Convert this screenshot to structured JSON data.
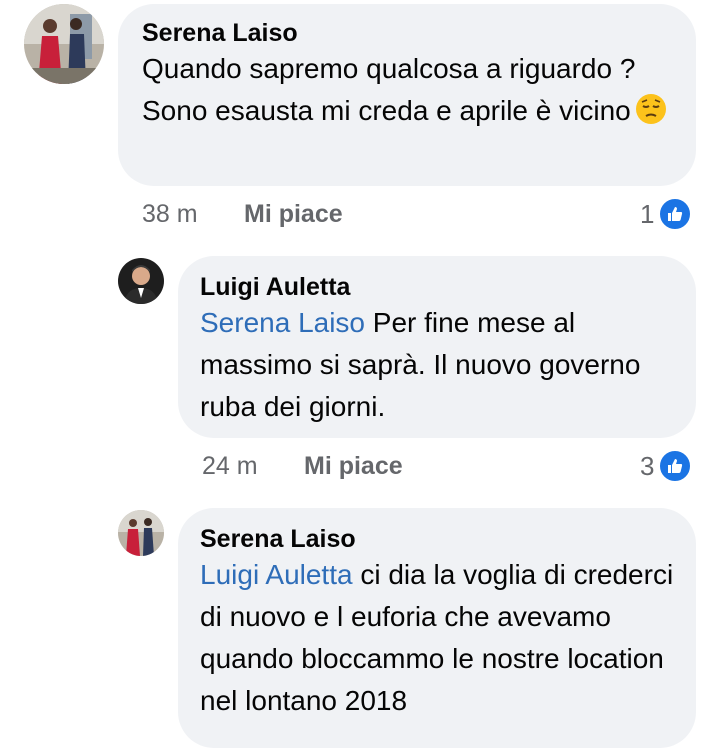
{
  "comments": [
    {
      "author": "Serena Laiso",
      "text": "Quando sapremo qualcosa a riguardo ? Sono esausta mi creda e aprile è vicino",
      "emoji": "pensive-face",
      "time": "38 m",
      "like_label": "Mi piace",
      "reaction_count": "1"
    },
    {
      "author": "Luigi Auletta",
      "mention": "Serena Laiso",
      "text": "Per fine mese al massimo si saprà.  Il nuovo governo ruba dei giorni.",
      "time": "24 m",
      "like_label": "Mi piace",
      "reaction_count": "3"
    },
    {
      "author": "Serena Laiso",
      "mention": "Luigi Auletta",
      "text": "ci dia la voglia di crederci di nuovo e l euforia che avevamo quando bloccammo le nostre location nel lontano 2018"
    }
  ],
  "colors": {
    "bubble": "#f0f2f5",
    "mention": "#2e6db8",
    "like_badge": "#1b74e4",
    "meta": "#65676b"
  }
}
